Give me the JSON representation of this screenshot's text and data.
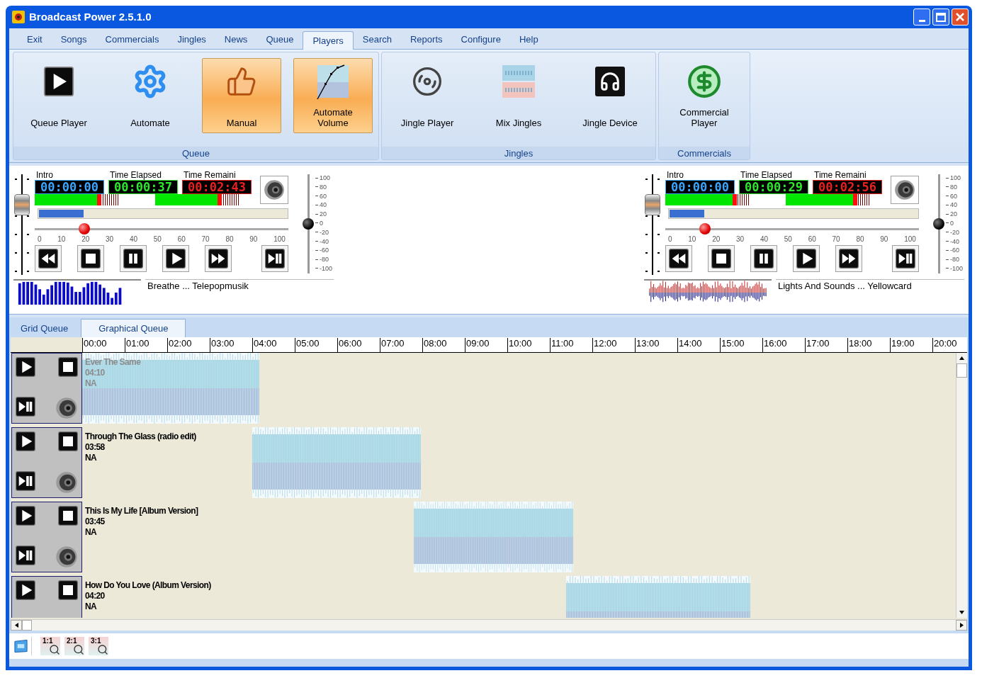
{
  "window": {
    "title": "Broadcast Power 2.5.1.0"
  },
  "menu_tabs": [
    {
      "label": "Exit",
      "selected": false
    },
    {
      "label": "Songs",
      "selected": false
    },
    {
      "label": "Commercials",
      "selected": false
    },
    {
      "label": "Jingles",
      "selected": false
    },
    {
      "label": "News",
      "selected": false
    },
    {
      "label": "Queue",
      "selected": false
    },
    {
      "label": "Players",
      "selected": true
    },
    {
      "label": "Search",
      "selected": false
    },
    {
      "label": "Reports",
      "selected": false
    },
    {
      "label": "Configure",
      "selected": false
    },
    {
      "label": "Help",
      "selected": false
    }
  ],
  "ribbon": {
    "groups": [
      {
        "label": "Queue",
        "buttons": [
          {
            "label": "Queue Player",
            "kind": "play",
            "on": false
          },
          {
            "label": "Automate",
            "kind": "gear",
            "on": false
          },
          {
            "label": "Manual",
            "kind": "thumb",
            "on": true
          },
          {
            "label": "Automate Volume",
            "kind": "curve",
            "on": true
          }
        ]
      },
      {
        "label": "Jingles",
        "buttons": [
          {
            "label": "Jingle Player",
            "kind": "disc",
            "on": false
          },
          {
            "label": "Mix Jingles",
            "kind": "mix",
            "on": false
          },
          {
            "label": "Jingle Device",
            "kind": "headphones",
            "on": false
          }
        ]
      },
      {
        "label": "Commercials",
        "buttons": [
          {
            "label": "Commercial Player",
            "kind": "dollar",
            "on": false
          }
        ]
      }
    ]
  },
  "players": [
    {
      "fader": {
        "level": 0.75
      },
      "timers": [
        {
          "label": "Intro",
          "value": "00:00:00",
          "color": "#3aa6ff"
        },
        {
          "label": "Time Elapsed",
          "value": "00:00:37",
          "color": "#2ee82e"
        },
        {
          "label": "Time Remaini",
          "value": "00:02:43",
          "color": "#e82020"
        }
      ],
      "meters": [
        {
          "level": 0.8
        },
        {
          "level": 0.8
        }
      ],
      "progress": {
        "level": 0.18
      },
      "position": {
        "level": 0.18
      },
      "position_ticks": [
        "0",
        "10",
        "20",
        "30",
        "40",
        "50",
        "60",
        "70",
        "80",
        "90",
        "100"
      ],
      "volume": {
        "level": 0.5
      },
      "volume_ticks": [
        "100",
        "80",
        "60",
        "40",
        "20",
        "0",
        "-20",
        "-40",
        "-60",
        "-80",
        "-100"
      ],
      "visual": {
        "kind": "spectrum"
      },
      "track": "Breathe ... Telepopmusik"
    },
    {
      "fader": {
        "level": 0.75
      },
      "timers": [
        {
          "label": "Intro",
          "value": "00:00:00",
          "color": "#3aa6ff"
        },
        {
          "label": "Time Elapsed",
          "value": "00:00:29",
          "color": "#2ee82e"
        },
        {
          "label": "Time Remaini",
          "value": "00:02:56",
          "color": "#e82020"
        }
      ],
      "meters": [
        {
          "level": 0.86
        },
        {
          "level": 0.86
        }
      ],
      "progress": {
        "level": 0.14
      },
      "position": {
        "level": 0.14
      },
      "position_ticks": [
        "0",
        "10",
        "20",
        "30",
        "40",
        "50",
        "60",
        "70",
        "80",
        "90",
        "100"
      ],
      "volume": {
        "level": 0.5
      },
      "volume_ticks": [
        "100",
        "80",
        "60",
        "40",
        "20",
        "0",
        "-20",
        "-40",
        "-60",
        "-80",
        "-100"
      ],
      "visual": {
        "kind": "oscilloscope"
      },
      "track": "Lights And Sounds ... Yellowcard"
    }
  ],
  "queue_tabs": [
    {
      "label": "Grid Queue",
      "selected": false
    },
    {
      "label": "Graphical Queue",
      "selected": true
    }
  ],
  "ruler": [
    "00:00",
    "01:00",
    "02:00",
    "03:00",
    "04:00",
    "05:00",
    "06:00",
    "07:00",
    "08:00",
    "09:00",
    "10:00",
    "11:00",
    "12:00",
    "13:00",
    "14:00",
    "15:00",
    "16:00",
    "17:00",
    "18:00",
    "19:00",
    "20:00"
  ],
  "queue": [
    {
      "title": "Ever The Same",
      "duration": "04:10",
      "artist": "NA",
      "played": true,
      "controls": [
        {
          "kind": "play"
        },
        {
          "kind": "stop"
        },
        {
          "kind": "play_pause"
        },
        {
          "kind": "speaker"
        }
      ]
    },
    {
      "title": "Through The Glass (radio edit)",
      "duration": "03:58",
      "artist": "NA",
      "played": false,
      "controls": [
        {
          "kind": "play"
        },
        {
          "kind": "stop"
        },
        {
          "kind": "play_pause"
        },
        {
          "kind": "speaker"
        }
      ]
    },
    {
      "title": "This Is My Life [Album Version]",
      "duration": "03:45",
      "artist": "NA",
      "played": false,
      "controls": [
        {
          "kind": "play"
        },
        {
          "kind": "stop"
        },
        {
          "kind": "play_pause"
        },
        {
          "kind": "speaker"
        }
      ]
    },
    {
      "title": "How Do You Love (Album Version)",
      "duration": "04:20",
      "artist": "NA",
      "played": false,
      "controls": [
        {
          "kind": "play"
        },
        {
          "kind": "stop"
        }
      ]
    }
  ],
  "toolbar": [
    {
      "kind": "queue"
    },
    {
      "kind": "zoom",
      "label": "1:1"
    },
    {
      "kind": "zoom",
      "label": "2:1"
    },
    {
      "kind": "zoom",
      "label": "3:1"
    }
  ]
}
